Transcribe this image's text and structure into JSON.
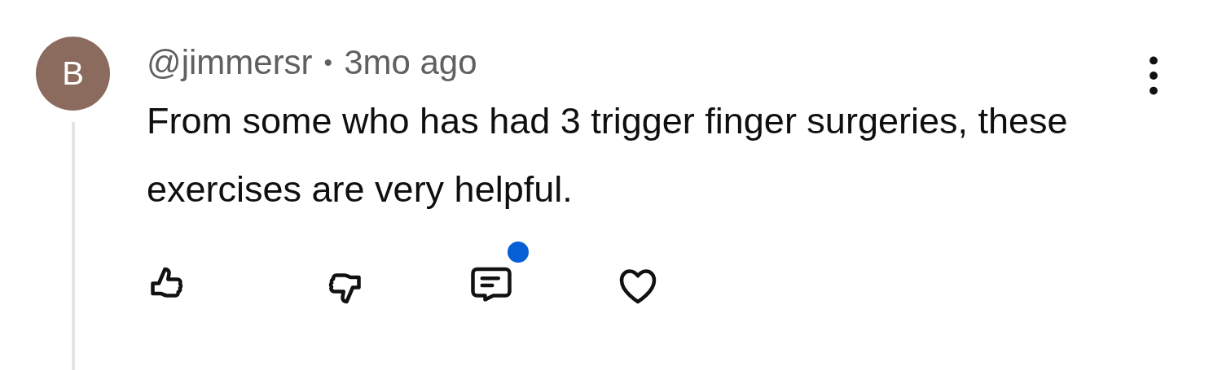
{
  "comment": {
    "avatar_letter": "B",
    "author": "@jimmersr",
    "separator": "•",
    "time": "3mo ago",
    "text": "From some who has had 3 trigger finger surgeries, these exercises are very helpful.",
    "replies_unread": true
  }
}
